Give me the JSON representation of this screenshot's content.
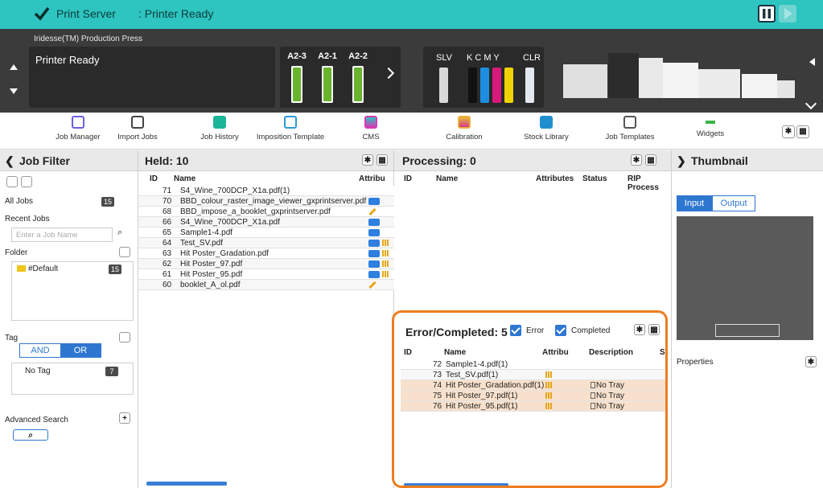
{
  "topbar": {
    "app_name": "Print Server",
    "status": ": Printer Ready"
  },
  "printer": {
    "model": "Iridesse(TM) Production Press",
    "status": "Printer Ready",
    "trays": [
      "A2-3",
      "A2-1",
      "A2-2"
    ],
    "ink_labels": {
      "slv": "SLV",
      "kcmy": "K  C  M  Y",
      "clr": "CLR"
    },
    "ink_colors": [
      "#d9d9d9",
      "#111111",
      "#1e8fe0",
      "#d6197a",
      "#f0d300",
      "#e3e7f0"
    ]
  },
  "toolbar": {
    "items": [
      "Job Manager",
      "Import Jobs",
      "Job History",
      "Imposition Template",
      "CMS",
      "Calibration",
      "Stock Library",
      "Job Templates",
      "Widgets"
    ]
  },
  "job_filter": {
    "title": "Job Filter",
    "all_jobs": "All Jobs",
    "all_jobs_count": "15",
    "recent_jobs": "Recent Jobs",
    "search_placeholder": "Enter a Job Name",
    "folder": "Folder",
    "default_folder": "#Default",
    "default_count": "15",
    "tag": "Tag",
    "and": "AND",
    "or": "OR",
    "no_tag": "No Tag",
    "no_tag_count": "7",
    "advanced_search": "Advanced Search"
  },
  "held": {
    "title": "Held: 10",
    "col_id": "ID",
    "col_name": "Name",
    "col_attr": "Attribu",
    "rows": [
      {
        "id": "71",
        "name": "S4_Wine_700DCP_X1a.pdf(1)",
        "attr": ""
      },
      {
        "id": "70",
        "name": "BBD_colour_raster_image_viewer_gxprintserver.pdf",
        "attr": "rip"
      },
      {
        "id": "68",
        "name": "BBD_impose_a_booklet_gxprintserver.pdf",
        "attr": "pencil"
      },
      {
        "id": "66",
        "name": "S4_Wine_700DCP_X1a.pdf",
        "attr": "rip"
      },
      {
        "id": "65",
        "name": "Sample1-4.pdf",
        "attr": "rip"
      },
      {
        "id": "64",
        "name": "Test_SV.pdf",
        "attr": "ripdots"
      },
      {
        "id": "63",
        "name": "Hit Poster_Gradation.pdf",
        "attr": "ripdots"
      },
      {
        "id": "62",
        "name": "Hit Poster_97.pdf",
        "attr": "ripdots"
      },
      {
        "id": "61",
        "name": "Hit Poster_95.pdf",
        "attr": "ripdots"
      },
      {
        "id": "60",
        "name": "booklet_A_ol.pdf",
        "attr": "pencil"
      }
    ]
  },
  "processing": {
    "title": "Processing: 0",
    "col_id": "ID",
    "col_name": "Name",
    "col_attr": "Attributes",
    "col_status": "Status",
    "col_rip": "RIP Process"
  },
  "error_completed": {
    "title": "Error/Completed: 5",
    "error_label": "Error",
    "completed_label": "Completed",
    "col_id": "ID",
    "col_name": "Name",
    "col_attr": "Attribu",
    "col_desc": "Description",
    "col_s": "S",
    "rows": [
      {
        "id": "72",
        "name": "Sample1-4.pdf(1)",
        "desc": "",
        "err": false
      },
      {
        "id": "73",
        "name": "Test_SV.pdf(1)",
        "desc": "",
        "err": false
      },
      {
        "id": "74",
        "name": "Hit Poster_Gradation.pdf(1)",
        "desc": "No Tray",
        "err": true
      },
      {
        "id": "75",
        "name": "Hit Poster_97.pdf(1)",
        "desc": "No Tray",
        "err": true
      },
      {
        "id": "76",
        "name": "Hit Poster_95.pdf(1)",
        "desc": "No Tray",
        "err": true
      }
    ]
  },
  "thumbnail": {
    "title": "Thumbnail",
    "tab_input": "Input",
    "tab_output": "Output",
    "properties": "Properties"
  }
}
